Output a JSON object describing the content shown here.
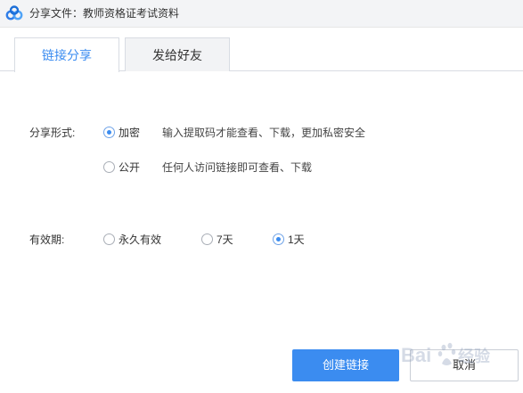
{
  "window": {
    "title": "分享文件：教师资格证考试资料",
    "logo_icon": "baidu-netdisk-logo-icon"
  },
  "tabs": [
    {
      "label": "链接分享",
      "active": true
    },
    {
      "label": "发给好友",
      "active": false
    }
  ],
  "share_form": {
    "label": "分享形式:",
    "options": [
      {
        "label": "加密",
        "checked": true,
        "description": "输入提取码才能查看、下载，更加私密安全"
      },
      {
        "label": "公开",
        "checked": false,
        "description": "任何人访问链接即可查看、下载"
      }
    ]
  },
  "validity": {
    "label": "有效期:",
    "options": [
      {
        "label": "永久有效",
        "checked": false
      },
      {
        "label": "7天",
        "checked": false
      },
      {
        "label": "1天",
        "checked": true
      }
    ]
  },
  "buttons": {
    "create_label": "创建链接",
    "cancel_label": "取消"
  },
  "colors": {
    "accent": "#3b8cf0",
    "titlebar_bg": "#f3f4f6",
    "tab_inactive_bg": "#f2f3f5"
  },
  "watermark": {
    "text": "Baidu经验"
  }
}
